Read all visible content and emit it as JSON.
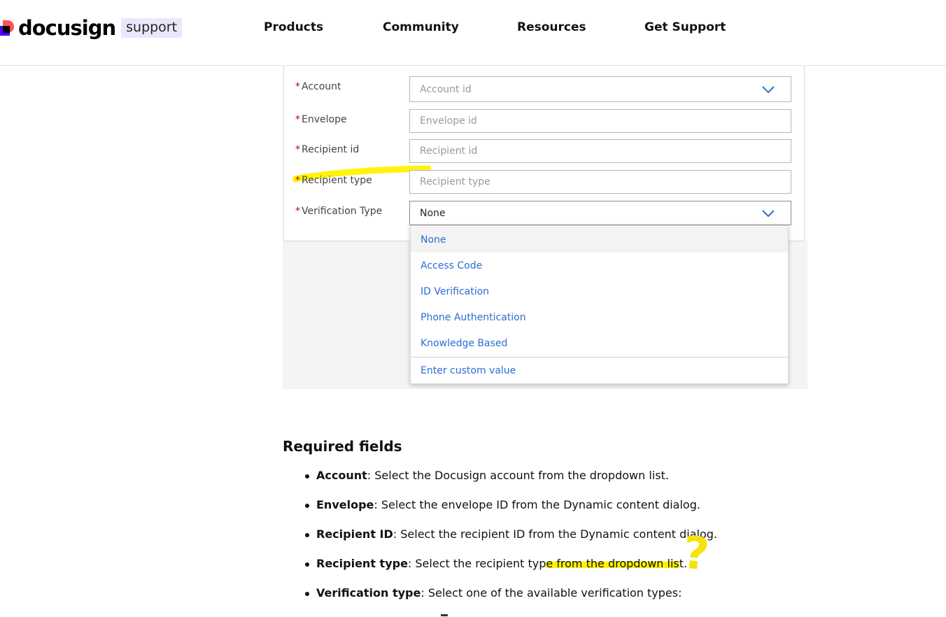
{
  "header": {
    "logo_text": "docusign",
    "logo_badge": "support",
    "nav": [
      {
        "label": "Products"
      },
      {
        "label": "Community"
      },
      {
        "label": "Resources"
      },
      {
        "label": "Get Support"
      }
    ]
  },
  "form": {
    "fields": [
      {
        "label": "Account",
        "required": "*",
        "placeholder": "Account id",
        "type": "dropdown"
      },
      {
        "label": "Envelope",
        "required": "*",
        "placeholder": "Envelope id",
        "type": "text"
      },
      {
        "label": "Recipient id",
        "required": "*",
        "placeholder": "Recipient id",
        "type": "text"
      },
      {
        "label": "Recipient type",
        "required": "*",
        "placeholder": "Recipient type",
        "type": "text"
      },
      {
        "label": "Verification Type",
        "required": "*",
        "value": "None",
        "type": "dropdown"
      }
    ],
    "verification_options": [
      {
        "label": "None",
        "active": true
      },
      {
        "label": "Access Code"
      },
      {
        "label": "ID Verification"
      },
      {
        "label": "Phone Authentication"
      },
      {
        "label": "Knowledge Based"
      }
    ],
    "custom_value_label": "Enter custom value"
  },
  "doc": {
    "title": "Required fields",
    "items": [
      {
        "term": "Account",
        "text": ": Select the Docusign account from the dropdown list."
      },
      {
        "term": "Envelope",
        "text": ": Select the envelope ID from the Dynamic content dialog."
      },
      {
        "term": "Recipient ID",
        "text": ": Select the recipient ID from the Dynamic content dialog."
      },
      {
        "term": "Recipient type",
        "text_before": ": Select the recipient typ",
        "text_marked": "e from the dropdown lis",
        "text_after": "t."
      },
      {
        "term": "Verification type",
        "text": ": Select one of the available verification types:"
      }
    ],
    "annotation": "?"
  },
  "colors": {
    "highlight": "#fff200",
    "link_blue": "#2b6ed1",
    "required_red": "#cc0000",
    "brand_purple": "#4c00ff",
    "brand_coral": "#ff5252"
  }
}
